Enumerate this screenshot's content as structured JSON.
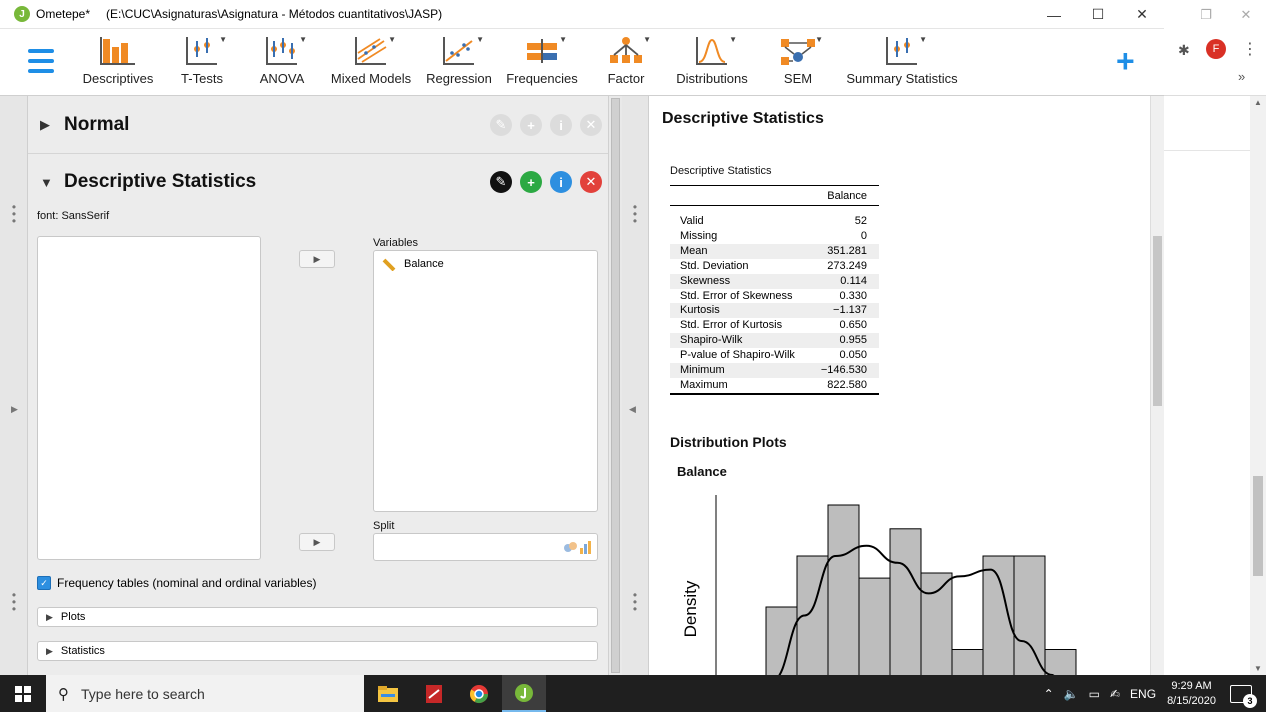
{
  "window": {
    "app_name": "Ometepe*",
    "path": "(E:\\CUC\\Asignaturas\\Asignatura - Métodos cuantitativos\\JASP)",
    "minimize": "—",
    "maximize": "☐",
    "close": "✕"
  },
  "browser": {
    "restore": "❐",
    "close": "✕",
    "avatar": "F",
    "more": "⋮",
    "overflow": "»"
  },
  "ribbon": {
    "items": [
      {
        "label": "Descriptives"
      },
      {
        "label": "T-Tests"
      },
      {
        "label": "ANOVA"
      },
      {
        "label": "Mixed Models"
      },
      {
        "label": "Regression"
      },
      {
        "label": "Frequencies"
      },
      {
        "label": "Factor"
      },
      {
        "label": "Distributions"
      },
      {
        "label": "SEM"
      },
      {
        "label": "Summary Statistics"
      }
    ],
    "accent": "#1e8ee6"
  },
  "analysis": {
    "collapsed_section": "Normal",
    "active_section": "Descriptive Statistics",
    "font_label": "font: SansSerif",
    "variables_label": "Variables",
    "variable": "Balance",
    "split_label": "Split",
    "frequency_tables": "Frequency tables (nominal and ordinal variables)",
    "plots": "Plots",
    "statistics": "Statistics"
  },
  "results": {
    "title": "Descriptive Statistics",
    "table_caption": "Descriptive Statistics",
    "column": "Balance",
    "rows": [
      {
        "label": "Valid",
        "value": "52"
      },
      {
        "label": "Missing",
        "value": "0"
      },
      {
        "label": "Mean",
        "value": "351.281"
      },
      {
        "label": "Std. Deviation",
        "value": "273.249"
      },
      {
        "label": "Skewness",
        "value": "0.114"
      },
      {
        "label": "Std. Error of Skewness",
        "value": "0.330"
      },
      {
        "label": "Kurtosis",
        "value": "−1.137"
      },
      {
        "label": "Std. Error of Kurtosis",
        "value": "0.650"
      },
      {
        "label": "Shapiro-Wilk",
        "value": "0.955"
      },
      {
        "label": "P-value of Shapiro-Wilk",
        "value": "0.050"
      },
      {
        "label": "Minimum",
        "value": "−146.530"
      },
      {
        "label": "Maximum",
        "value": "822.580"
      }
    ],
    "distribution_title": "Distribution Plots",
    "plot_variable": "Balance",
    "plot_ylabel": "Density",
    "histogram_relative_heights": [
      0.4,
      0.7,
      1.0,
      0.57,
      0.86,
      0.6,
      0.15,
      0.7,
      0.7,
      0.15
    ],
    "density_relative_heights": [
      0.0,
      0.35,
      0.7,
      0.76,
      0.66,
      0.48,
      0.58,
      0.62,
      0.2,
      0.0
    ]
  },
  "taskbar": {
    "search_placeholder": "Type here to search",
    "language": "ENG",
    "time": "9:29 AM",
    "date": "8/15/2020",
    "notifications": "3"
  }
}
